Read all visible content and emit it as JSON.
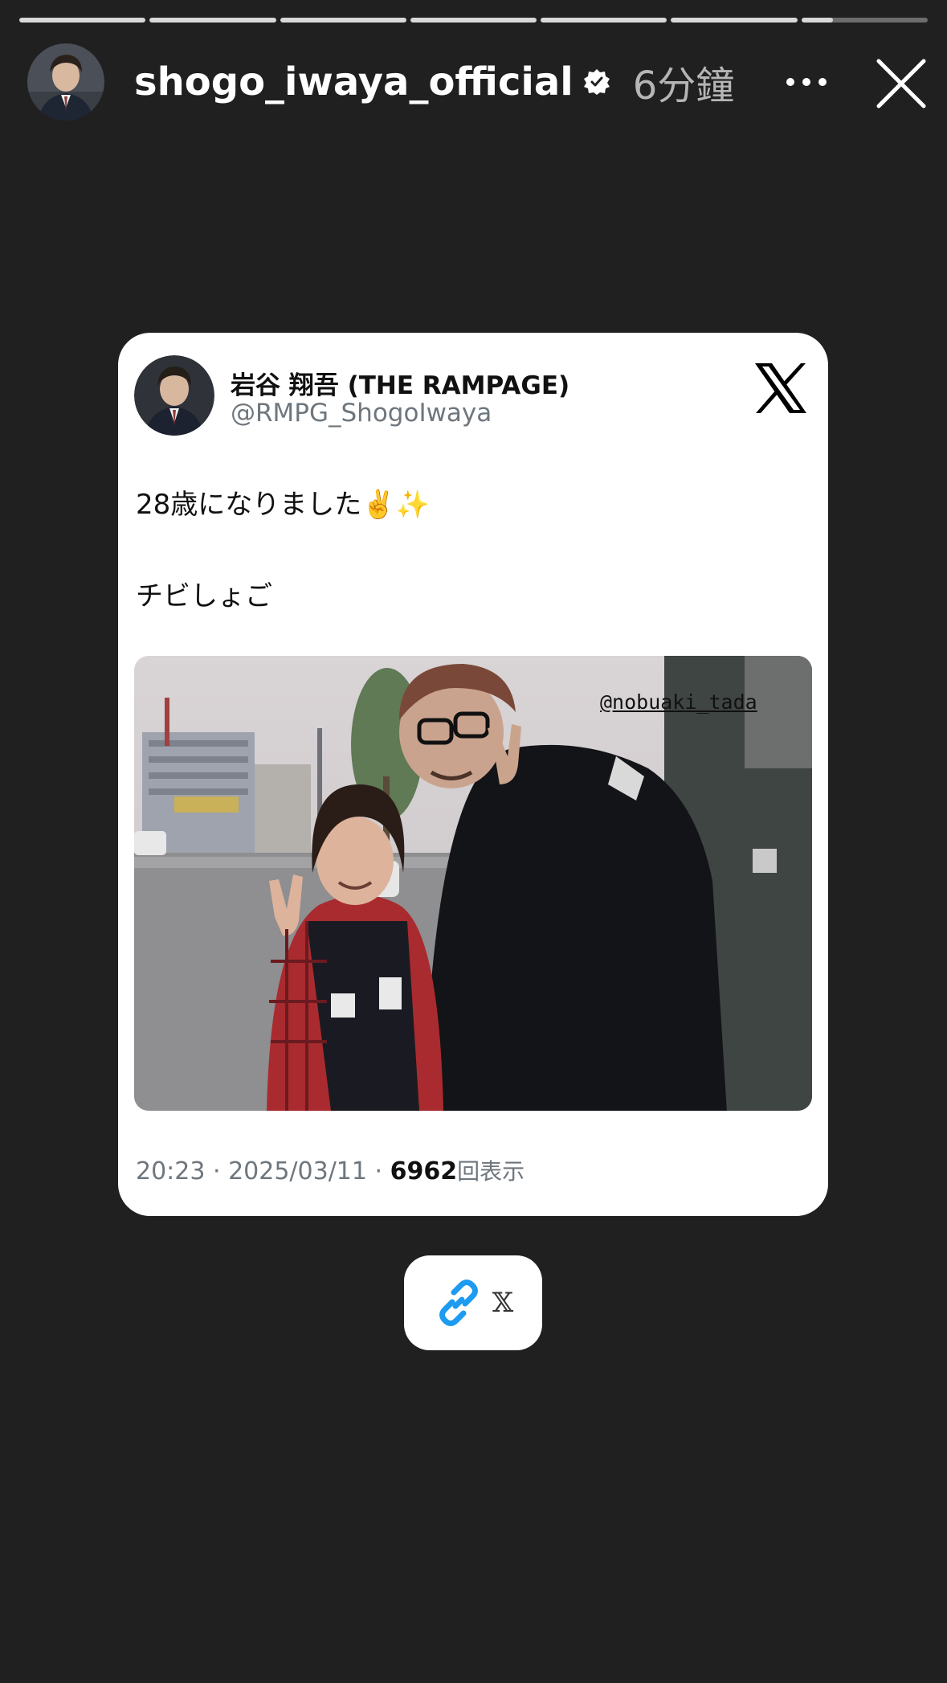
{
  "story": {
    "progress": [
      1,
      1,
      1,
      1,
      1,
      1,
      0.25
    ],
    "username": "shogo_iwaya_official",
    "verified_icon": "verified-badge-icon",
    "time_ago": "6分鐘",
    "more_icon": "more-horizontal-icon",
    "close_icon": "close-icon"
  },
  "tweet_card": {
    "display_name": "岩谷 翔吾 (THE RAMPAGE)",
    "handle": "@RMPG_ShogoIwaya",
    "logo_icon": "x-logo-icon",
    "text_line1": "28歳になりました✌️✨",
    "text_line2": "チビしょご",
    "photo_tag": "@nobuaki_tada",
    "meta_prefix": "20:23 · 2025/03/11 · ",
    "views_count": "6962",
    "views_unit": "回表示"
  },
  "link_sticker": {
    "icon": "link-icon",
    "label": "𝕏"
  },
  "colors": {
    "background": "#202020",
    "card": "#ffffff",
    "link_blue": "#1d9bf0",
    "muted_text": "#6e767d"
  }
}
